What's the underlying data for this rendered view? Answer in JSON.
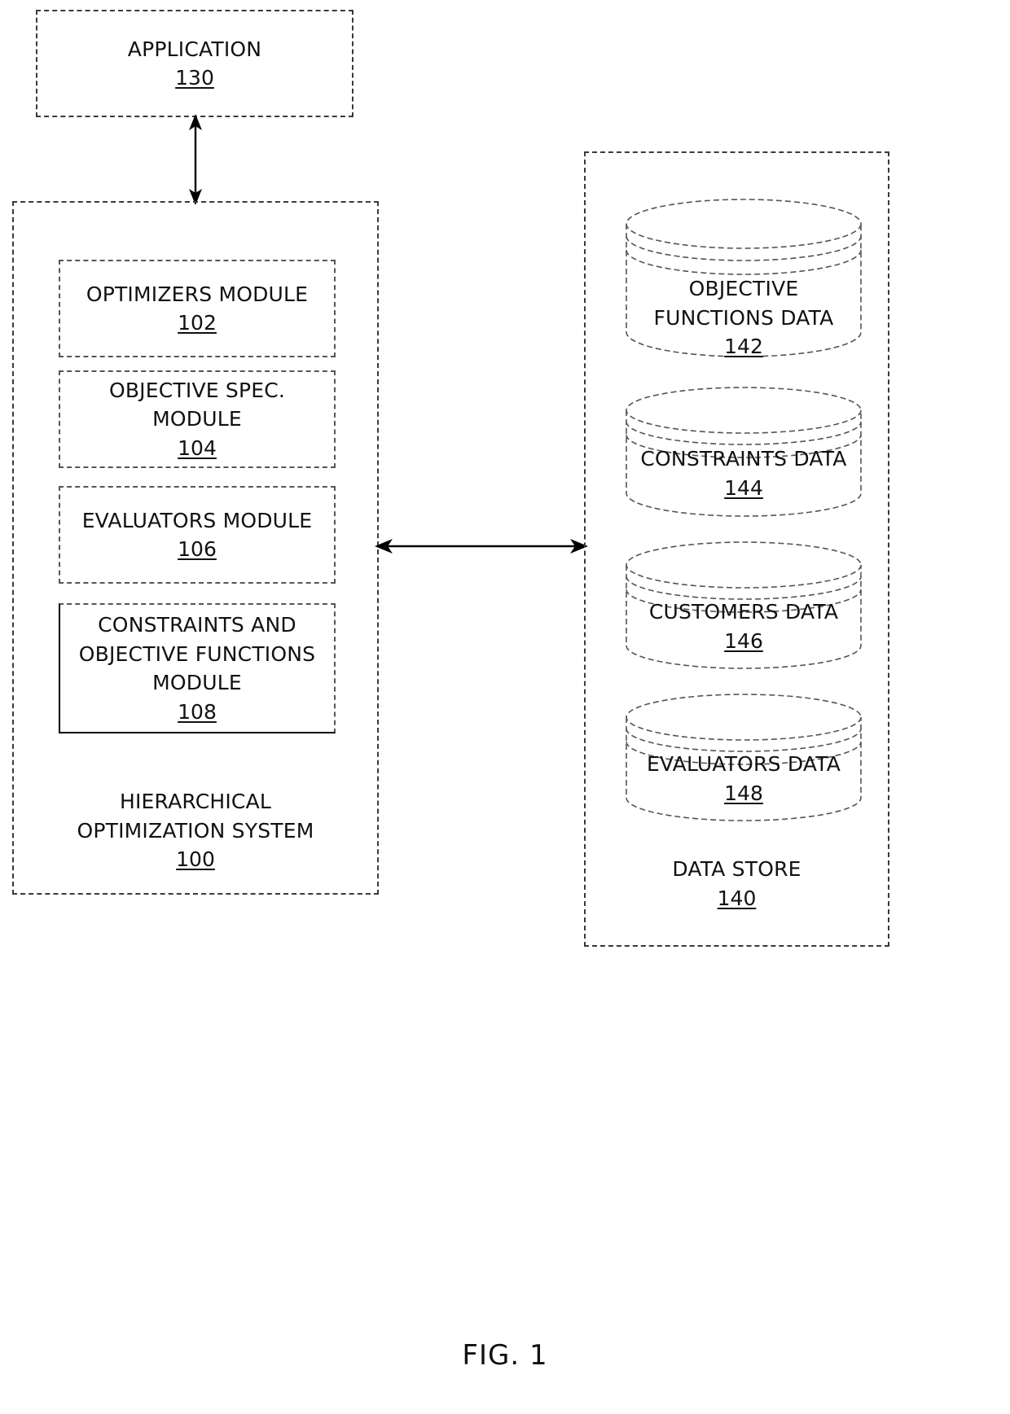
{
  "figure": {
    "caption": "FIG. 1"
  },
  "application": {
    "label": "APPLICATION",
    "ref": "130"
  },
  "system": {
    "label": "HIERARCHICAL\nOPTIMIZATION SYSTEM",
    "ref": "100",
    "modules": [
      {
        "label": "OPTIMIZERS MODULE",
        "ref": "102",
        "name": "optimizers-module"
      },
      {
        "label": "OBJECTIVE SPEC.\nMODULE",
        "ref": "104",
        "name": "objective-spec-module"
      },
      {
        "label": "EVALUATORS MODULE",
        "ref": "106",
        "name": "evaluators-module"
      },
      {
        "label": "CONSTRAINTS AND\nOBJECTIVE FUNCTIONS\nMODULE",
        "ref": "108",
        "name": "constraints-and-objective-functions-module"
      }
    ]
  },
  "data_store": {
    "label": "DATA STORE",
    "ref": "140",
    "stores": [
      {
        "label": "OBJECTIVE\nFUNCTIONS DATA",
        "ref": "142",
        "name": "objective-functions-data"
      },
      {
        "label": "CONSTRAINTS DATA",
        "ref": "144",
        "name": "constraints-data"
      },
      {
        "label": "CUSTOMERS DATA",
        "ref": "146",
        "name": "customers-data"
      },
      {
        "label": "EVALUATORS DATA",
        "ref": "148",
        "name": "evaluators-data"
      }
    ]
  },
  "connectors": [
    {
      "name": "application-to-system-connector",
      "direction": "bidirectional",
      "orientation": "vertical"
    },
    {
      "name": "system-to-datastore-connector",
      "direction": "bidirectional",
      "orientation": "horizontal"
    }
  ],
  "colors": {
    "stroke": "#000000",
    "dashed_stroke": "#3a3a3a",
    "background": "#ffffff"
  }
}
